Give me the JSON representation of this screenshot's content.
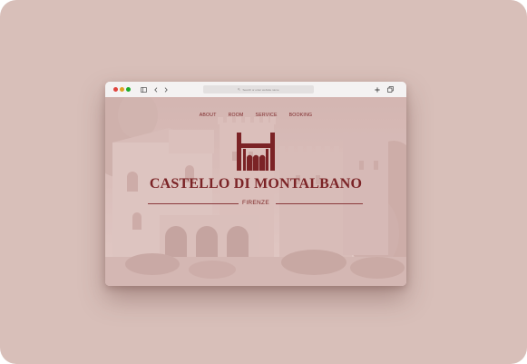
{
  "browser": {
    "address_text": "Search or enter website name",
    "icons": [
      "sidebar-icon",
      "back-icon",
      "forward-icon",
      "new-tab-icon",
      "tabs-overview-icon"
    ]
  },
  "site": {
    "nav": [
      "ABOUT",
      "ROOM",
      "SERVICE",
      "BOOKING"
    ],
    "title": "CASTELLO DI MONTALBANO",
    "subtitle": "FIRENZE"
  },
  "colors": {
    "brand": "#7b2326",
    "background": "#d8bfb9"
  }
}
